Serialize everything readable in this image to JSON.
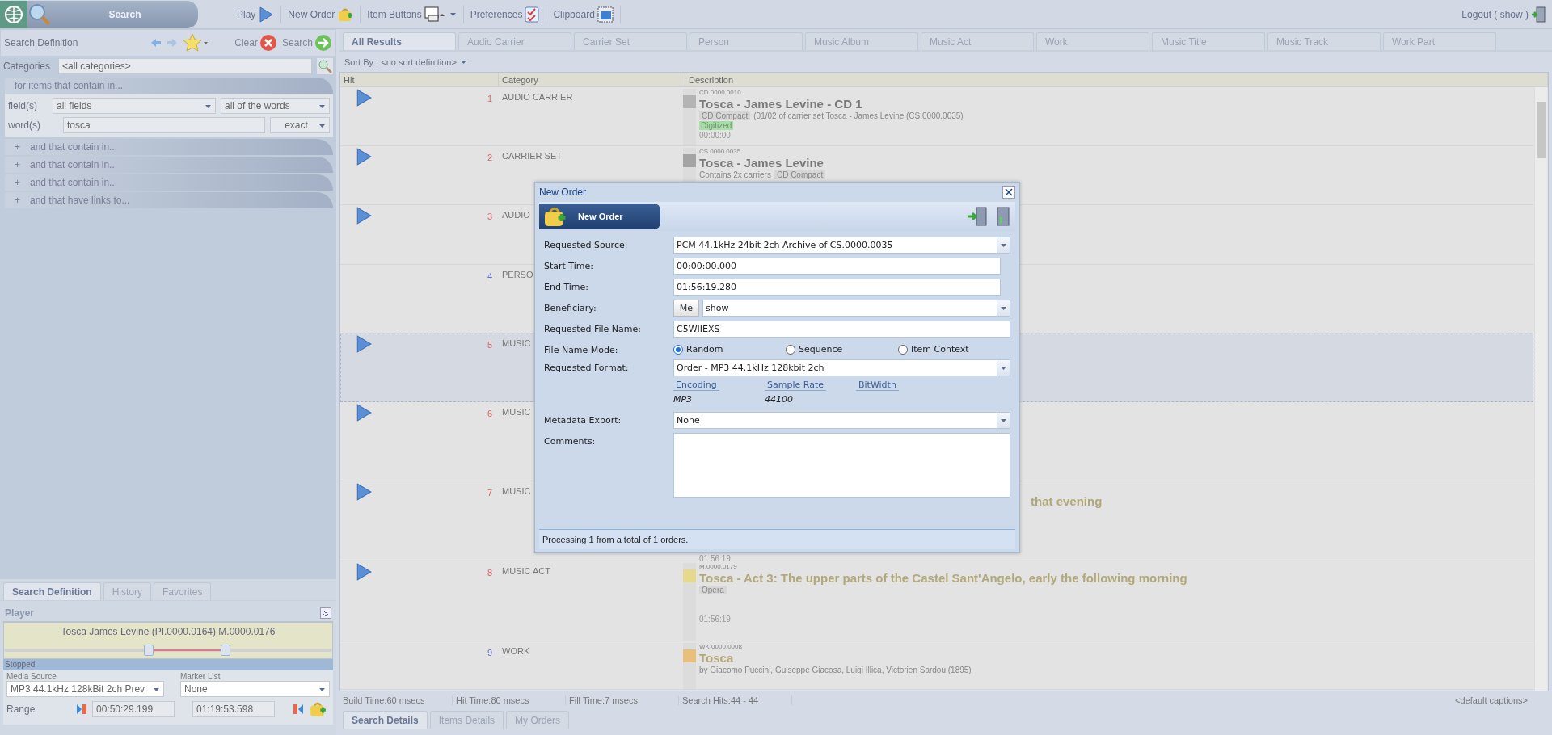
{
  "app_bar": {
    "search_label": "Search"
  },
  "toolbar": [
    {
      "label": "Play",
      "kind": "play"
    },
    {
      "label": "New Order",
      "kind": "bag"
    },
    {
      "label": "Item Buttons",
      "kind": "buttons"
    },
    {
      "label": "Preferences",
      "kind": "checklist"
    },
    {
      "label": "Clipboard",
      "kind": "clipboard"
    }
  ],
  "logout": "Logout ( show )",
  "search_panel": {
    "title": "Search Definition",
    "clear": "Clear",
    "search": "Search",
    "categories_label": "Categories",
    "categories_value": "<all categories>",
    "criteria_title": "for items that contain in...",
    "fields_label": "field(s)",
    "fields_value": "all fields",
    "match_value": "all of the words",
    "words_label": "word(s)",
    "words_value": "tosca",
    "mode_value": "exact",
    "more": [
      {
        "expand": "+",
        "label": "and that contain in..."
      },
      {
        "expand": "+",
        "label": "and that contain in..."
      },
      {
        "expand": "+",
        "label": "and that contain in..."
      },
      {
        "expand": "+",
        "label": "and that have links to..."
      }
    ]
  },
  "left_tabs": [
    {
      "label": "Search Definition",
      "selected": true
    },
    {
      "label": "History",
      "selected": false
    },
    {
      "label": "Favorites",
      "selected": false
    }
  ],
  "player": {
    "title": "Player",
    "track": "Tosca James Levine (PI.0000.0164) M.0000.0176",
    "handles": [
      {
        "level": 0.44
      },
      {
        "level": 0.68
      }
    ],
    "status": "Stopped",
    "media_source_label": "Media Source",
    "media_source": "MP3 44.1kHz 128kBit 2ch Prev",
    "marker_list_label": "Marker List",
    "marker_list": "None",
    "range_label": "Range",
    "range_start": "00:50:29.199",
    "range_end": "01:19:53.598"
  },
  "result_tabs": [
    {
      "label": "All Results",
      "selected": true
    },
    {
      "label": "Audio Carrier",
      "selected": false
    },
    {
      "label": "Carrier Set",
      "selected": false
    },
    {
      "label": "Person",
      "selected": false
    },
    {
      "label": "Music Album",
      "selected": false
    },
    {
      "label": "Music Act",
      "selected": false
    },
    {
      "label": "Work",
      "selected": false
    },
    {
      "label": "Music Title",
      "selected": false
    },
    {
      "label": "Music Track",
      "selected": false
    },
    {
      "label": "Work Part",
      "selected": false
    }
  ],
  "sort_by": "Sort By : <no sort definition>",
  "columns": [
    "Hit",
    "Category",
    "Description"
  ],
  "rows": [
    {
      "hit": "1",
      "category": "AUDIO CARRIER",
      "playable": true,
      "selected": false,
      "description": {
        "kind": "full",
        "color": "#b4b4b4",
        "id": "CD.0000.0010",
        "title": "Tosca - James Levine - CD 1",
        "tag": "CD Compact",
        "text": "(01/02 of carrier set Tosca - James Levine (CS.0000.0035)",
        "badge": "Digitized",
        "time": "00:00:00"
      }
    },
    {
      "hit": "2",
      "category": "CARRIER SET",
      "playable": true,
      "selected": false,
      "description": {
        "kind": "full",
        "color": "#a4a4a4",
        "id": "CS.0000.0035",
        "title": "Tosca - James Levine",
        "text": "Contains 2x carriers",
        "tag": "CD Compact"
      }
    },
    {
      "hit": "3",
      "category": "AUDIO",
      "playable": true,
      "selected": false
    },
    {
      "hit": "4",
      "category": "PERSO",
      "playable": false,
      "selected": false
    },
    {
      "hit": "5",
      "category": "MUSIC",
      "playable": true,
      "selected": true
    },
    {
      "hit": "6",
      "category": "MUSIC",
      "playable": true,
      "selected": false
    },
    {
      "hit": "7",
      "category": "MUSIC",
      "playable": true,
      "selected": false,
      "description": {
        "kind": "partial",
        "title": "that evening",
        "time": "01:56:19"
      }
    },
    {
      "hit": "8",
      "category": "MUSIC ACT",
      "playable": true,
      "selected": false,
      "description": {
        "kind": "full",
        "color": "#e6d98c",
        "id": "M.0000.0179",
        "title": "Tosca - Act 3: The upper parts of the Castel Sant'Angelo, early the following morning",
        "tag": "Opera",
        "time": "01:56:19"
      }
    },
    {
      "hit": "9",
      "category": "WORK",
      "playable": false,
      "selected": false,
      "description": {
        "kind": "full",
        "color": "#e8c07c",
        "id": "WK.0000.0008",
        "title": "Tosca",
        "text": "by Giacomo Puccini, Guiseppe Giacosa, Luigi Illica, Victorien Sardou (1895)"
      }
    }
  ],
  "status_bar": [
    "Build Time:60 msecs",
    "Hit Time:80 msecs",
    "Fill Time:7 msecs",
    "Search Hits:44 - 44"
  ],
  "captions": "<default captions>",
  "bottom_tabs": [
    {
      "label": "Search Details",
      "selected": true
    },
    {
      "label": "Items Details",
      "selected": false
    },
    {
      "label": "My Orders",
      "selected": false
    }
  ],
  "dialog": {
    "title": "New Order",
    "header_button": "New Order",
    "fields": [
      {
        "kind": "select",
        "label": "Requested Source:",
        "value": "PCM 44.1kHz 24bit 2ch Archive of CS.0000.0035"
      },
      {
        "kind": "text",
        "label": "Start Time:",
        "value": "00:00:00.000"
      },
      {
        "kind": "text",
        "label": "End Time:",
        "value": "01:56:19.280"
      },
      {
        "kind": "beneficiary",
        "label": "Beneficiary:",
        "button": "Me",
        "value": "show"
      },
      {
        "kind": "text",
        "label": "Requested File Name:",
        "value": "C5WIIEXS"
      },
      {
        "kind": "radio",
        "label": "File Name Mode:",
        "options": [
          {
            "label": "Random",
            "selected": true
          },
          {
            "label": "Sequence",
            "selected": false
          },
          {
            "label": "Item Context",
            "selected": false
          }
        ]
      },
      {
        "kind": "format",
        "label": "Requested Format:",
        "value": "Order - MP3 44.1kHz 128kbit 2ch",
        "columns": [
          {
            "heading": "Encoding",
            "value": "MP3"
          },
          {
            "heading": "Sample Rate",
            "value": "44100"
          },
          {
            "heading": "BitWidth"
          }
        ]
      },
      {
        "kind": "select",
        "label": "Metadata Export:",
        "value": "None"
      },
      {
        "kind": "textarea",
        "label": "Comments:"
      }
    ],
    "status": "Processing 1 from a total of 1 orders."
  }
}
